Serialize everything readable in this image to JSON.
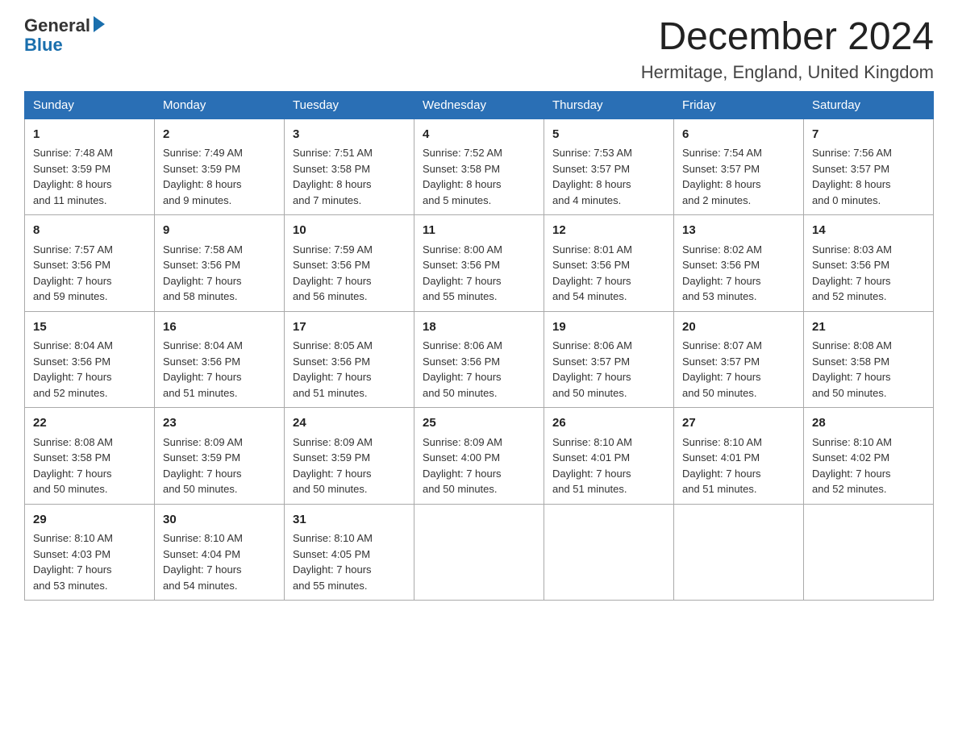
{
  "header": {
    "title": "December 2024",
    "subtitle": "Hermitage, England, United Kingdom",
    "logo_general": "General",
    "logo_blue": "Blue"
  },
  "days_of_week": [
    "Sunday",
    "Monday",
    "Tuesday",
    "Wednesday",
    "Thursday",
    "Friday",
    "Saturday"
  ],
  "weeks": [
    [
      {
        "day": "1",
        "info": "Sunrise: 7:48 AM\nSunset: 3:59 PM\nDaylight: 8 hours\nand 11 minutes."
      },
      {
        "day": "2",
        "info": "Sunrise: 7:49 AM\nSunset: 3:59 PM\nDaylight: 8 hours\nand 9 minutes."
      },
      {
        "day": "3",
        "info": "Sunrise: 7:51 AM\nSunset: 3:58 PM\nDaylight: 8 hours\nand 7 minutes."
      },
      {
        "day": "4",
        "info": "Sunrise: 7:52 AM\nSunset: 3:58 PM\nDaylight: 8 hours\nand 5 minutes."
      },
      {
        "day": "5",
        "info": "Sunrise: 7:53 AM\nSunset: 3:57 PM\nDaylight: 8 hours\nand 4 minutes."
      },
      {
        "day": "6",
        "info": "Sunrise: 7:54 AM\nSunset: 3:57 PM\nDaylight: 8 hours\nand 2 minutes."
      },
      {
        "day": "7",
        "info": "Sunrise: 7:56 AM\nSunset: 3:57 PM\nDaylight: 8 hours\nand 0 minutes."
      }
    ],
    [
      {
        "day": "8",
        "info": "Sunrise: 7:57 AM\nSunset: 3:56 PM\nDaylight: 7 hours\nand 59 minutes."
      },
      {
        "day": "9",
        "info": "Sunrise: 7:58 AM\nSunset: 3:56 PM\nDaylight: 7 hours\nand 58 minutes."
      },
      {
        "day": "10",
        "info": "Sunrise: 7:59 AM\nSunset: 3:56 PM\nDaylight: 7 hours\nand 56 minutes."
      },
      {
        "day": "11",
        "info": "Sunrise: 8:00 AM\nSunset: 3:56 PM\nDaylight: 7 hours\nand 55 minutes."
      },
      {
        "day": "12",
        "info": "Sunrise: 8:01 AM\nSunset: 3:56 PM\nDaylight: 7 hours\nand 54 minutes."
      },
      {
        "day": "13",
        "info": "Sunrise: 8:02 AM\nSunset: 3:56 PM\nDaylight: 7 hours\nand 53 minutes."
      },
      {
        "day": "14",
        "info": "Sunrise: 8:03 AM\nSunset: 3:56 PM\nDaylight: 7 hours\nand 52 minutes."
      }
    ],
    [
      {
        "day": "15",
        "info": "Sunrise: 8:04 AM\nSunset: 3:56 PM\nDaylight: 7 hours\nand 52 minutes."
      },
      {
        "day": "16",
        "info": "Sunrise: 8:04 AM\nSunset: 3:56 PM\nDaylight: 7 hours\nand 51 minutes."
      },
      {
        "day": "17",
        "info": "Sunrise: 8:05 AM\nSunset: 3:56 PM\nDaylight: 7 hours\nand 51 minutes."
      },
      {
        "day": "18",
        "info": "Sunrise: 8:06 AM\nSunset: 3:56 PM\nDaylight: 7 hours\nand 50 minutes."
      },
      {
        "day": "19",
        "info": "Sunrise: 8:06 AM\nSunset: 3:57 PM\nDaylight: 7 hours\nand 50 minutes."
      },
      {
        "day": "20",
        "info": "Sunrise: 8:07 AM\nSunset: 3:57 PM\nDaylight: 7 hours\nand 50 minutes."
      },
      {
        "day": "21",
        "info": "Sunrise: 8:08 AM\nSunset: 3:58 PM\nDaylight: 7 hours\nand 50 minutes."
      }
    ],
    [
      {
        "day": "22",
        "info": "Sunrise: 8:08 AM\nSunset: 3:58 PM\nDaylight: 7 hours\nand 50 minutes."
      },
      {
        "day": "23",
        "info": "Sunrise: 8:09 AM\nSunset: 3:59 PM\nDaylight: 7 hours\nand 50 minutes."
      },
      {
        "day": "24",
        "info": "Sunrise: 8:09 AM\nSunset: 3:59 PM\nDaylight: 7 hours\nand 50 minutes."
      },
      {
        "day": "25",
        "info": "Sunrise: 8:09 AM\nSunset: 4:00 PM\nDaylight: 7 hours\nand 50 minutes."
      },
      {
        "day": "26",
        "info": "Sunrise: 8:10 AM\nSunset: 4:01 PM\nDaylight: 7 hours\nand 51 minutes."
      },
      {
        "day": "27",
        "info": "Sunrise: 8:10 AM\nSunset: 4:01 PM\nDaylight: 7 hours\nand 51 minutes."
      },
      {
        "day": "28",
        "info": "Sunrise: 8:10 AM\nSunset: 4:02 PM\nDaylight: 7 hours\nand 52 minutes."
      }
    ],
    [
      {
        "day": "29",
        "info": "Sunrise: 8:10 AM\nSunset: 4:03 PM\nDaylight: 7 hours\nand 53 minutes."
      },
      {
        "day": "30",
        "info": "Sunrise: 8:10 AM\nSunset: 4:04 PM\nDaylight: 7 hours\nand 54 minutes."
      },
      {
        "day": "31",
        "info": "Sunrise: 8:10 AM\nSunset: 4:05 PM\nDaylight: 7 hours\nand 55 minutes."
      },
      {
        "day": "",
        "info": ""
      },
      {
        "day": "",
        "info": ""
      },
      {
        "day": "",
        "info": ""
      },
      {
        "day": "",
        "info": ""
      }
    ]
  ]
}
